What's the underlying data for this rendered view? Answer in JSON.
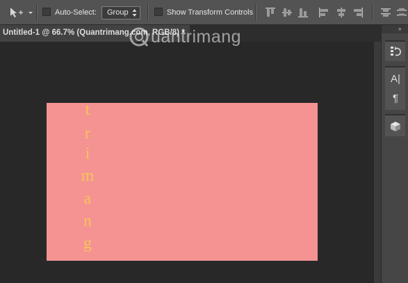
{
  "options_bar": {
    "auto_select_label": "Auto-Select:",
    "auto_select_value": "Group",
    "show_transform_label": "Show Transform Controls"
  },
  "document": {
    "tab_title": "Untitled-1 @ 66.7% (Quantrimang.com, RGB/8) *",
    "close_glyph": "×"
  },
  "canvas": {
    "background": "#f59393",
    "text_color": "#f7c35a",
    "vertical_text": [
      "t",
      "r",
      "i",
      "m",
      "a",
      "n",
      "g"
    ]
  },
  "watermark": {
    "text": "uantrimang",
    "mark": "Q"
  },
  "dock": {
    "collapse_glyph": "»",
    "character_glyph": "A|",
    "paragraph_glyph": "¶"
  }
}
